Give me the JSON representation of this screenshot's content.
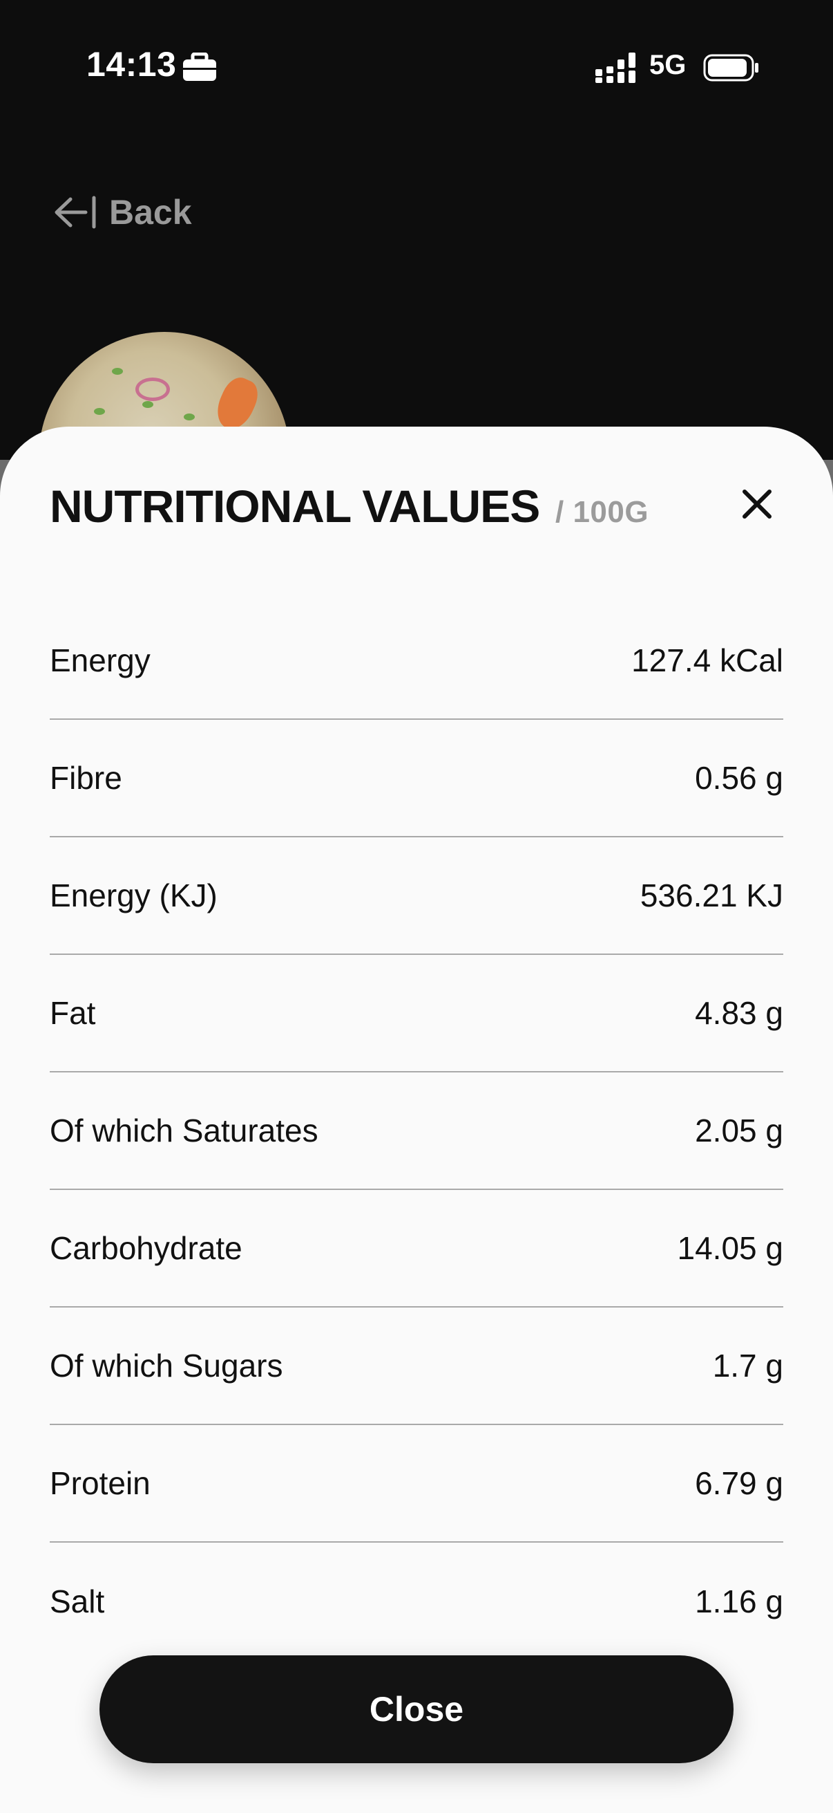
{
  "status_bar": {
    "time": "14:13",
    "network": "5G"
  },
  "nav": {
    "back_label": "Back"
  },
  "sheet": {
    "title": "NUTRITIONAL VALUES",
    "unit": "/ 100G",
    "rows": [
      {
        "label": "Energy",
        "value": "127.4 kCal"
      },
      {
        "label": "Fibre",
        "value": "0.56 g"
      },
      {
        "label": "Energy (KJ)",
        "value": "536.21 KJ"
      },
      {
        "label": "Fat",
        "value": "4.83 g"
      },
      {
        "label": "Of which Saturates",
        "value": "2.05 g"
      },
      {
        "label": "Carbohydrate",
        "value": "14.05 g"
      },
      {
        "label": "Of which Sugars",
        "value": "1.7 g"
      },
      {
        "label": "Protein",
        "value": "6.79 g"
      },
      {
        "label": "Salt",
        "value": "1.16 g"
      }
    ],
    "close_button_label": "Close"
  },
  "colors": {
    "background": "#0d0d0d",
    "sheet": "#fafafa",
    "button": "#131313",
    "muted": "#9b9b9b"
  }
}
